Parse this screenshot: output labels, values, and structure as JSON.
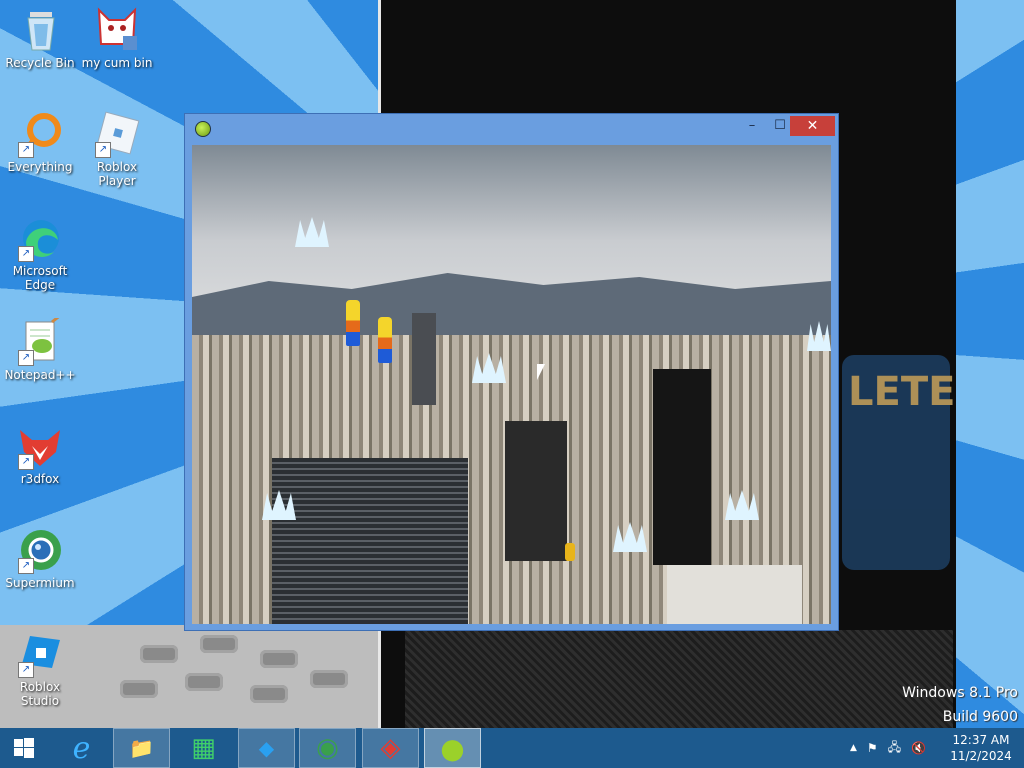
{
  "desktop": {
    "icons": [
      {
        "label": "Recycle Bin",
        "icon": "recycle-bin-icon",
        "shortcut": false
      },
      {
        "label": "my cum bin",
        "icon": "cat-recycle-icon",
        "shortcut": false
      },
      {
        "label": "Everything",
        "icon": "search-ring-icon",
        "shortcut": true
      },
      {
        "label": "Roblox Player",
        "icon": "roblox-icon",
        "shortcut": true
      },
      {
        "label": "Microsoft Edge",
        "icon": "edge-icon",
        "shortcut": true
      },
      {
        "label": "Notepad++",
        "icon": "notepad-icon",
        "shortcut": true
      },
      {
        "label": "r3dfox",
        "icon": "fox-icon",
        "shortcut": true
      },
      {
        "label": "Supermium",
        "icon": "supermium-icon",
        "shortcut": true
      },
      {
        "label": "Roblox Studio",
        "icon": "roblox-studio-icon",
        "shortcut": true
      }
    ],
    "watermark": {
      "line1": "Windows 8.1 Pro",
      "line2": "Build 9600"
    },
    "wallpaper_sticker_text": "LETE"
  },
  "window": {
    "title": "",
    "buttons": {
      "minimize": "–",
      "maximize": "☐",
      "close": "✕"
    },
    "app_icon": "green-ball-icon"
  },
  "taskbar": {
    "start_icon": "windows-start-icon",
    "apps": [
      {
        "name": "internet-explorer",
        "glyph": "e",
        "state": "normal"
      },
      {
        "name": "file-explorer",
        "glyph": "📁",
        "state": "pinned"
      },
      {
        "name": "store",
        "glyph": "▦",
        "state": "normal"
      },
      {
        "name": "roblox-studio",
        "glyph": "◆",
        "state": "pinned"
      },
      {
        "name": "supermium",
        "glyph": "◉",
        "state": "pinned"
      },
      {
        "name": "r3dfox",
        "glyph": "◈",
        "state": "pinned"
      },
      {
        "name": "green-ball-app",
        "glyph": "●",
        "state": "active"
      }
    ],
    "tray": {
      "chevron": "▲",
      "flag": "⚑",
      "network": "🖧",
      "volume": "🔇"
    },
    "clock": {
      "time": "12:37 AM",
      "date": "11/2/2024"
    }
  },
  "colors": {
    "taskbar": "#1d5a8e",
    "window_frame": "#6a9ee0",
    "close_button": "#c7403a",
    "desktop_blue": "#2f8be0"
  }
}
